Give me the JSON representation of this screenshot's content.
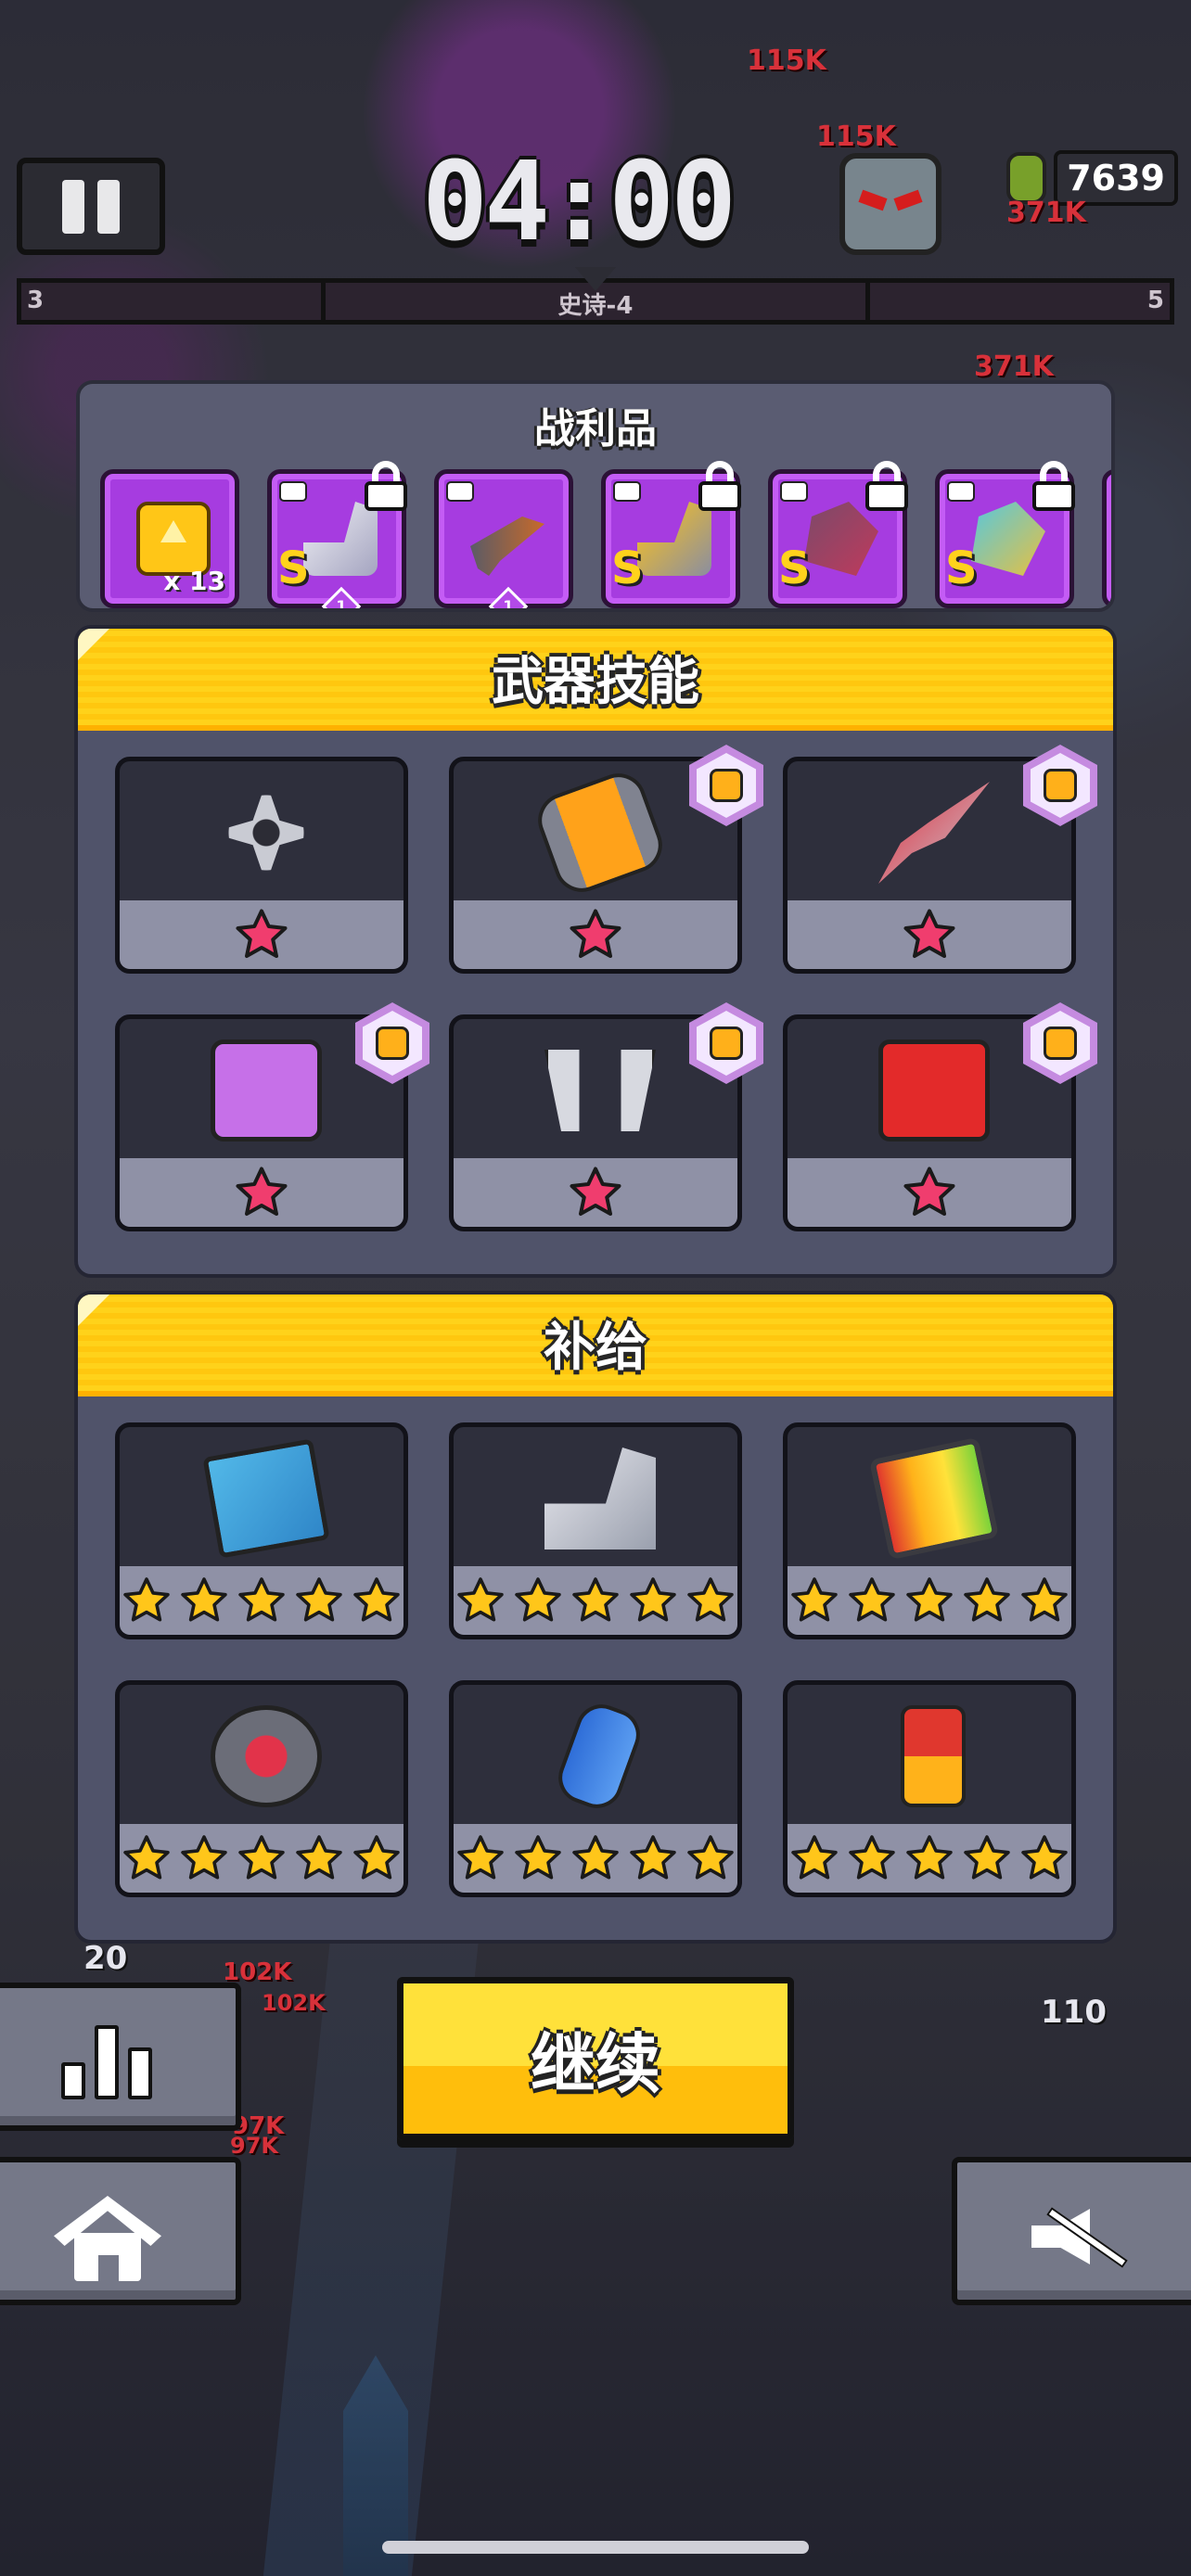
{
  "hud": {
    "timer": "04:00",
    "kill_count": "7639",
    "stage_left": "3",
    "stage_label": "史诗-4",
    "stage_right": "5",
    "damage_numbers": [
      "115K",
      "115K",
      "371K",
      "371K",
      "102K",
      "102K",
      "97K",
      "97K"
    ],
    "counter_small": "20",
    "counter_right": "110"
  },
  "loot": {
    "title": "战利品",
    "items": [
      {
        "art": "upgrade-card-icon",
        "count": "x 13",
        "grade": "",
        "locked": false,
        "level": ""
      },
      {
        "art": "sneaker-icon",
        "count": "",
        "grade": "S",
        "locked": true,
        "level": "1"
      },
      {
        "art": "shotgun-icon",
        "count": "",
        "grade": "",
        "locked": false,
        "level": "1"
      },
      {
        "art": "boot-icon",
        "count": "",
        "grade": "S",
        "locked": true,
        "level": ""
      },
      {
        "art": "gauntlet-icon",
        "count": "",
        "grade": "S",
        "locked": true,
        "level": ""
      },
      {
        "art": "gauntlet-icon",
        "count": "",
        "grade": "S",
        "locked": true,
        "level": ""
      }
    ]
  },
  "weapon_skills": {
    "title": "武器技能",
    "items": [
      {
        "art": "shuriken-icon",
        "stars": 1,
        "badge": false
      },
      {
        "art": "energy-cell-icon",
        "stars": 1,
        "badge": true
      },
      {
        "art": "kunai-icon",
        "stars": 1,
        "badge": true
      },
      {
        "art": "game-console-icon",
        "stars": 1,
        "badge": true
      },
      {
        "art": "drone-icon",
        "stars": 1,
        "badge": true
      },
      {
        "art": "fuel-can-icon",
        "stars": 1,
        "badge": true
      }
    ]
  },
  "supplies": {
    "title": "补给",
    "items": [
      {
        "art": "travel-book-icon",
        "stars": 5
      },
      {
        "art": "sneaker-icon",
        "stars": 5
      },
      {
        "art": "battery-pack-icon",
        "stars": 5
      },
      {
        "art": "energy-core-icon",
        "stars": 5
      },
      {
        "art": "oxygen-tank-icon",
        "stars": 5
      },
      {
        "art": "battery-icon",
        "stars": 5
      }
    ]
  },
  "buttons": {
    "continue": "继续",
    "stats_icon": "bar-chart-icon",
    "home_icon": "home-icon",
    "sound_icon": "mute-icon"
  },
  "colors": {
    "accent_yellow": "#ffc70f",
    "loot_purple": "#a63ce0",
    "star_pink": "#f03d6e",
    "star_gold": "#ffc61a",
    "damage_red": "#d8313a"
  }
}
